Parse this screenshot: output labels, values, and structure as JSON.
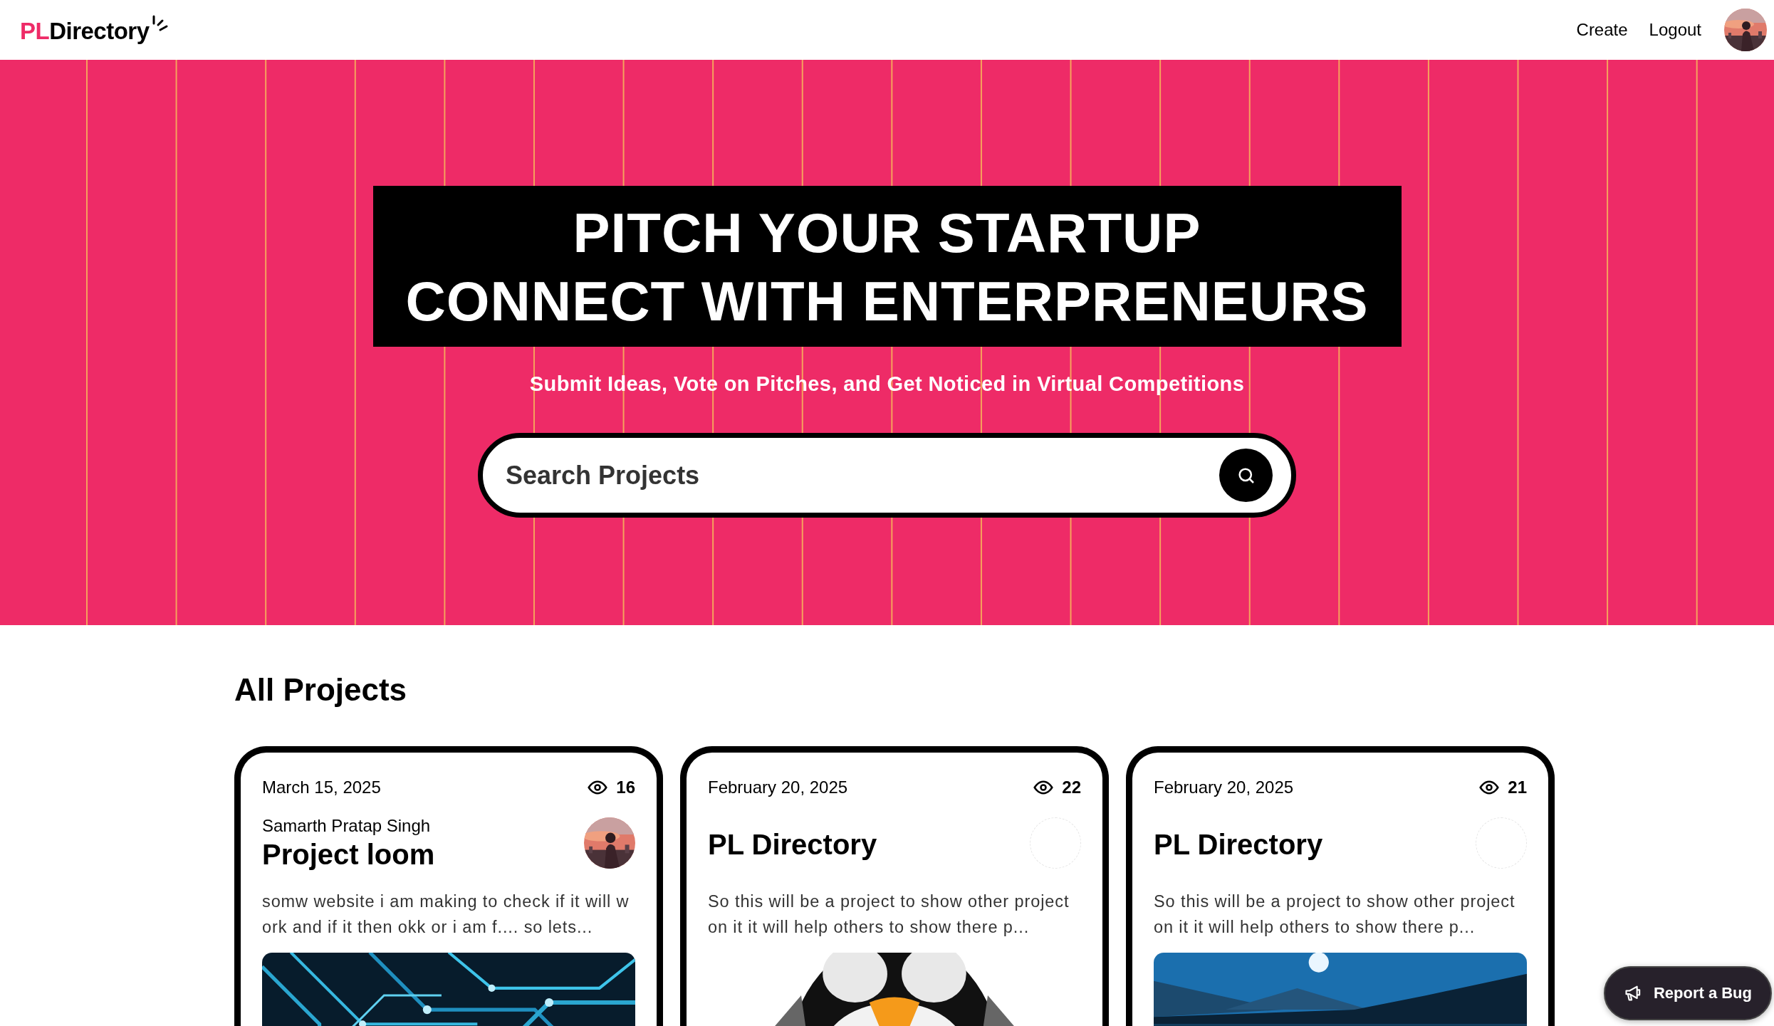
{
  "header": {
    "logo": {
      "accent": "PL",
      "text": "Directory"
    },
    "nav": [
      "Create",
      "Logout"
    ]
  },
  "hero": {
    "title_lines": [
      "PITCH YOUR STARTUP",
      "CONNECT WITH ENTERPRENEURS"
    ],
    "subtitle": "Submit Ideas, Vote on Pitches, and Get Noticed in Virtual Competitions",
    "search": {
      "placeholder": "Search Projects"
    }
  },
  "projects": {
    "heading": "All Projects",
    "cards": [
      {
        "date": "March 15, 2025",
        "views": "16",
        "author": "Samarth Pratap Singh",
        "title": "Project loom",
        "avatar_loaded": true,
        "description": "somw website i am making to check if it will work and if it then okk or i am f.... so lets..."
      },
      {
        "date": "February 20, 2025",
        "views": "22",
        "title": "PL Directory",
        "avatar_loaded": false,
        "description": "So this will be a project to show other project on it it will help others to show there p..."
      },
      {
        "date": "February 20, 2025",
        "views": "21",
        "title": "PL Directory",
        "avatar_loaded": false,
        "description": "So this will be a project to show other project on it it will help others to show there p..."
      }
    ]
  },
  "report_button": "Report a Bug"
}
